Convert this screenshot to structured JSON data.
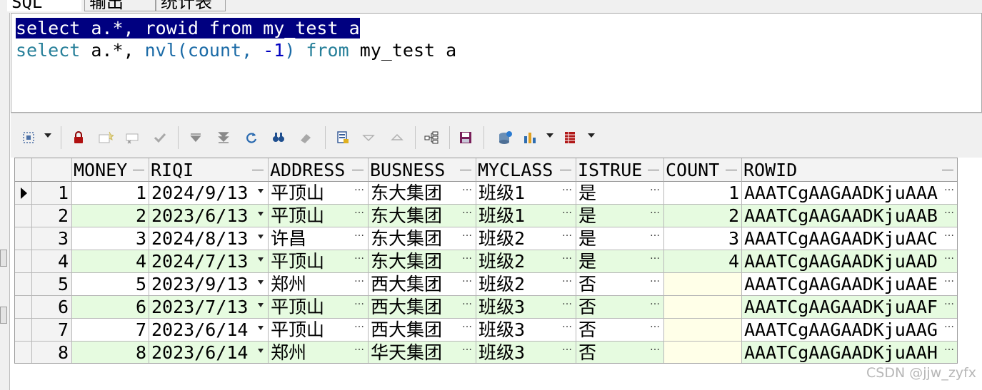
{
  "tabs": [
    "SQL",
    "输出",
    "统计表"
  ],
  "editor": {
    "line1": "select a.*, rowid from my_test a",
    "line2": {
      "kw1": "select",
      "p1": " a.*, ",
      "fn": "nvl",
      "p2": "(count, ",
      "num": "-1",
      "p3": ") ",
      "kw2": "from",
      "p4": " my_test a"
    }
  },
  "grid": {
    "columns": [
      "MONEY",
      "RIQI",
      "ADDRESS",
      "BUSNESS",
      "MYCLASS",
      "ISTRUE",
      "COUNT",
      "ROWID"
    ],
    "rows": [
      {
        "num": "1",
        "money": "1",
        "riqi": "2024/9/13",
        "address": "平顶山",
        "busness": "东大集团",
        "myclass": "班级1",
        "istrue": "是",
        "count": "1",
        "rowid": "AAATCgAAGAADKjuAAA"
      },
      {
        "num": "2",
        "money": "2",
        "riqi": "2023/6/13",
        "address": "平顶山",
        "busness": "东大集团",
        "myclass": "班级1",
        "istrue": "是",
        "count": "2",
        "rowid": "AAATCgAAGAADKjuAAB"
      },
      {
        "num": "3",
        "money": "3",
        "riqi": "2024/8/13",
        "address": "许昌",
        "busness": "东大集团",
        "myclass": "班级2",
        "istrue": "是",
        "count": "3",
        "rowid": "AAATCgAAGAADKjuAAC"
      },
      {
        "num": "4",
        "money": "4",
        "riqi": "2024/7/13",
        "address": "平顶山",
        "busness": "东大集团",
        "myclass": "班级2",
        "istrue": "是",
        "count": "4",
        "rowid": "AAATCgAAGAADKjuAAD"
      },
      {
        "num": "5",
        "money": "5",
        "riqi": "2023/9/13",
        "address": "郑州",
        "busness": "西大集团",
        "myclass": "班级2",
        "istrue": "否",
        "count": "",
        "rowid": "AAATCgAAGAADKjuAAE"
      },
      {
        "num": "6",
        "money": "6",
        "riqi": "2023/7/13",
        "address": "平顶山",
        "busness": "西大集团",
        "myclass": "班级3",
        "istrue": "否",
        "count": "",
        "rowid": "AAATCgAAGAADKjuAAF"
      },
      {
        "num": "7",
        "money": "7",
        "riqi": "2023/6/14",
        "address": "平顶山",
        "busness": "西大集团",
        "myclass": "班级3",
        "istrue": "否",
        "count": "",
        "rowid": "AAATCgAAGAADKjuAAG"
      },
      {
        "num": "8",
        "money": "8",
        "riqi": "2023/6/14",
        "address": "郑州",
        "busness": "华天集团",
        "myclass": "班级3",
        "istrue": "否",
        "count": "",
        "rowid": "AAATCgAAGAADKjuAAH"
      }
    ]
  },
  "toolbar": {
    "icons": [
      "select-mode-icon",
      "lock-icon",
      "insert-record-icon",
      "delete-record-icon",
      "post-changes-icon",
      "next-page-icon",
      "last-page-icon",
      "refresh-icon",
      "find-icon",
      "clear-icon",
      "query-by-example-icon",
      "filter-icon",
      "sort-icon",
      "export-tree-icon",
      "save-icon",
      "database-icon",
      "chart-icon",
      "grid-view-icon"
    ]
  },
  "colors": {
    "selection": "#000080",
    "alt_row": "#e6fbe0",
    "null_cell": "#ffffe8",
    "keyword": "#267f99"
  },
  "watermark": "CSDN @jjw_zyfx"
}
